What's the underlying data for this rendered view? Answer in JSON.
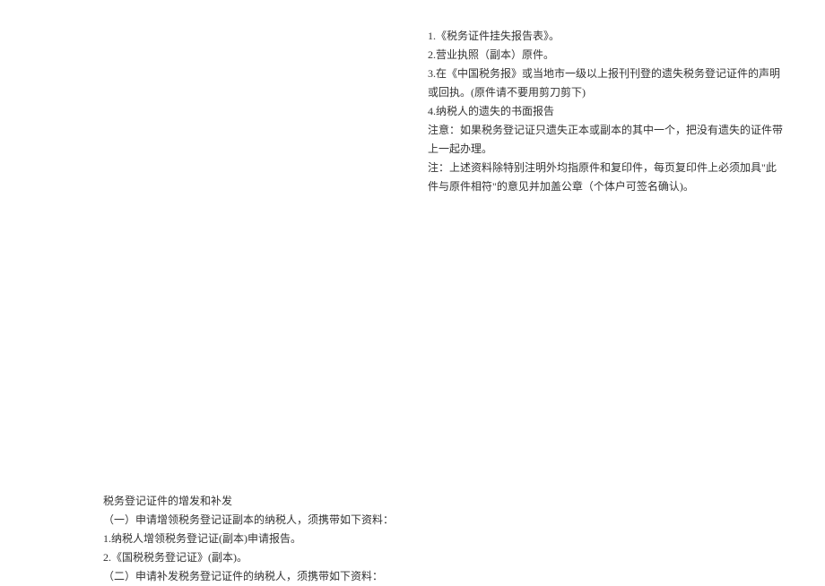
{
  "top": {
    "line1": "1.《税务证件挂失报告表》。",
    "line2": "2.营业执照（副本）原件。",
    "line3": "3.在《中国税务报》或当地市一级以上报刊刊登的遗失税务登记证件的声明或回执。(原件请不要用剪刀剪下)",
    "line4": "4.纳税人的遗失的书面报告",
    "line5": "注意：如果税务登记证只遗失正本或副本的其中一个，把没有遗失的证件带上一起办理。",
    "line6": "注：上述资料除特别注明外均指原件和复印件，每页复印件上必须加具\"此件与原件相符\"的意见并加盖公章（个体户可签名确认)。"
  },
  "bottom": {
    "title": "税务登记证件的增发和补发",
    "line1": "（一）申请增领税务登记证副本的纳税人，须携带如下资料：",
    "line2": "1.纳税人增领税务登记证(副本)申请报告。",
    "line3": "2.《国税税务登记证》(副本)。",
    "line4": "（二）申请补发税务登记证件的纳税人，须携带如下资料："
  }
}
